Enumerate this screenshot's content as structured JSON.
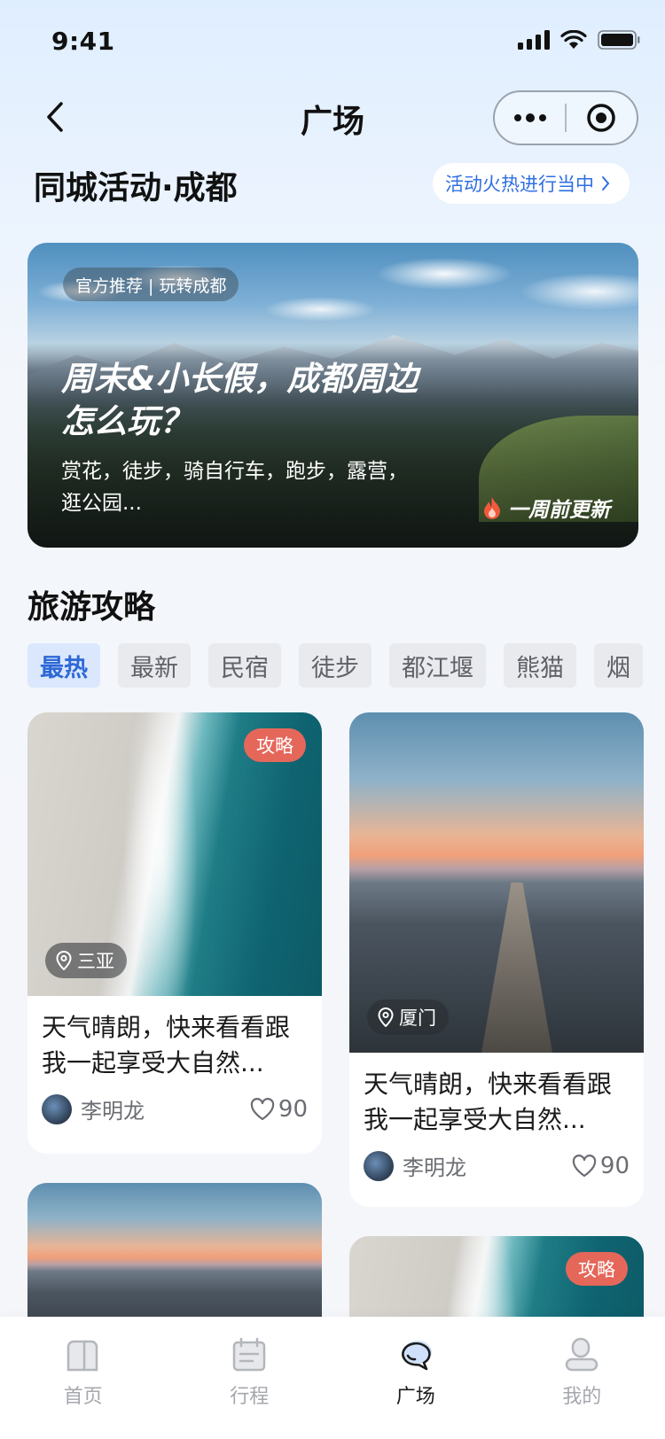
{
  "status_bar": {
    "time": "9:41"
  },
  "nav": {
    "title": "广场"
  },
  "activity": {
    "title": "同城活动·成都",
    "hot_label": "活动火热进行当中"
  },
  "hero": {
    "tag": "官方推荐 | 玩转成都",
    "title": "周末&小长假，成都周边怎么玩？",
    "desc": "赏花，徒步，骑自行车，跑步，露营，逛公园...",
    "update": "一周前更新"
  },
  "guide": {
    "title": "旅游攻略",
    "filters": [
      "最热",
      "最新",
      "民宿",
      "徒步",
      "都江堰",
      "熊猫",
      "烟"
    ]
  },
  "cards": [
    {
      "badge": "攻略",
      "location": "三亚",
      "title": "天气晴朗，快来看看跟我一起享受大自然...",
      "author": "李明龙",
      "likes": "90"
    },
    {
      "badge": "",
      "location": "厦门",
      "title": "天气晴朗，快来看看跟我一起享受大自然...",
      "author": "李明龙",
      "likes": "90"
    },
    {
      "badge": "",
      "location": "",
      "title": "",
      "author": "",
      "likes": ""
    },
    {
      "badge": "攻略",
      "location": "",
      "title": "",
      "author": "",
      "likes": ""
    }
  ],
  "tabbar": {
    "items": [
      {
        "label": "首页",
        "icon": "home-icon"
      },
      {
        "label": "行程",
        "icon": "calendar-icon"
      },
      {
        "label": "广场",
        "icon": "chat-bubbles-icon",
        "active": true
      },
      {
        "label": "我的",
        "icon": "profile-icon"
      }
    ]
  },
  "colors": {
    "accent": "#2d68d6",
    "badge": "#e5675a",
    "pill_text": "#2f6fe0"
  }
}
